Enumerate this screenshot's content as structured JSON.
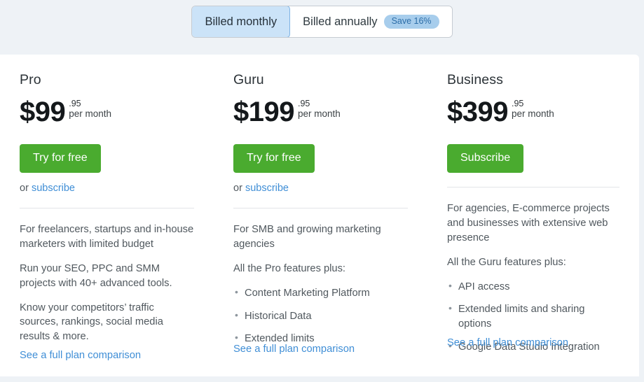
{
  "billing_toggle": {
    "monthly_label": "Billed monthly",
    "annually_label": "Billed annually",
    "save_badge": "Save 16%",
    "active": "monthly",
    "active_bg": "#cbe3f8",
    "badge_bg": "#a7cdec",
    "badge_color": "#2c6ea8"
  },
  "theme": {
    "page_bg": "#eef2f6",
    "card_bg": "#ffffff",
    "cta_green": "#4aab2f",
    "link_blue": "#3f8ed6",
    "body_text": "#50585e"
  },
  "plans": [
    {
      "name": "Pro",
      "price_main": "$99",
      "price_cents": ".95",
      "price_period": "per month",
      "cta_label": "Try for free",
      "or_text": "or",
      "subscribe_label": "subscribe",
      "paragraphs": [
        "For freelancers, startups and in-house marketers with limited budget",
        "Run your SEO, PPC and SMM projects with 40+ advanced tools.",
        "Know your competitors’ traffic sources, rankings, social media results & more."
      ],
      "bullets": [],
      "compare_label": "See a full plan comparison"
    },
    {
      "name": "Guru",
      "price_main": "$199",
      "price_cents": ".95",
      "price_period": "per month",
      "cta_label": "Try for free",
      "or_text": "or",
      "subscribe_label": "subscribe",
      "paragraphs": [
        "For SMB and growing marketing agencies",
        "All the Pro features plus:"
      ],
      "bullets": [
        "Content Marketing Platform",
        "Historical Data",
        "Extended limits"
      ],
      "compare_label": "See a full plan comparison"
    },
    {
      "name": "Business",
      "price_main": "$399",
      "price_cents": ".95",
      "price_period": "per month",
      "cta_label": "Subscribe",
      "or_text": "",
      "subscribe_label": "",
      "paragraphs": [
        "For agencies, E-commerce projects and businesses with extensive web presence",
        "All the Guru features plus:"
      ],
      "bullets": [
        "API access",
        "Extended limits and sharing options",
        "Google Data Studio Integration"
      ],
      "compare_label": "See a full plan comparison"
    }
  ]
}
